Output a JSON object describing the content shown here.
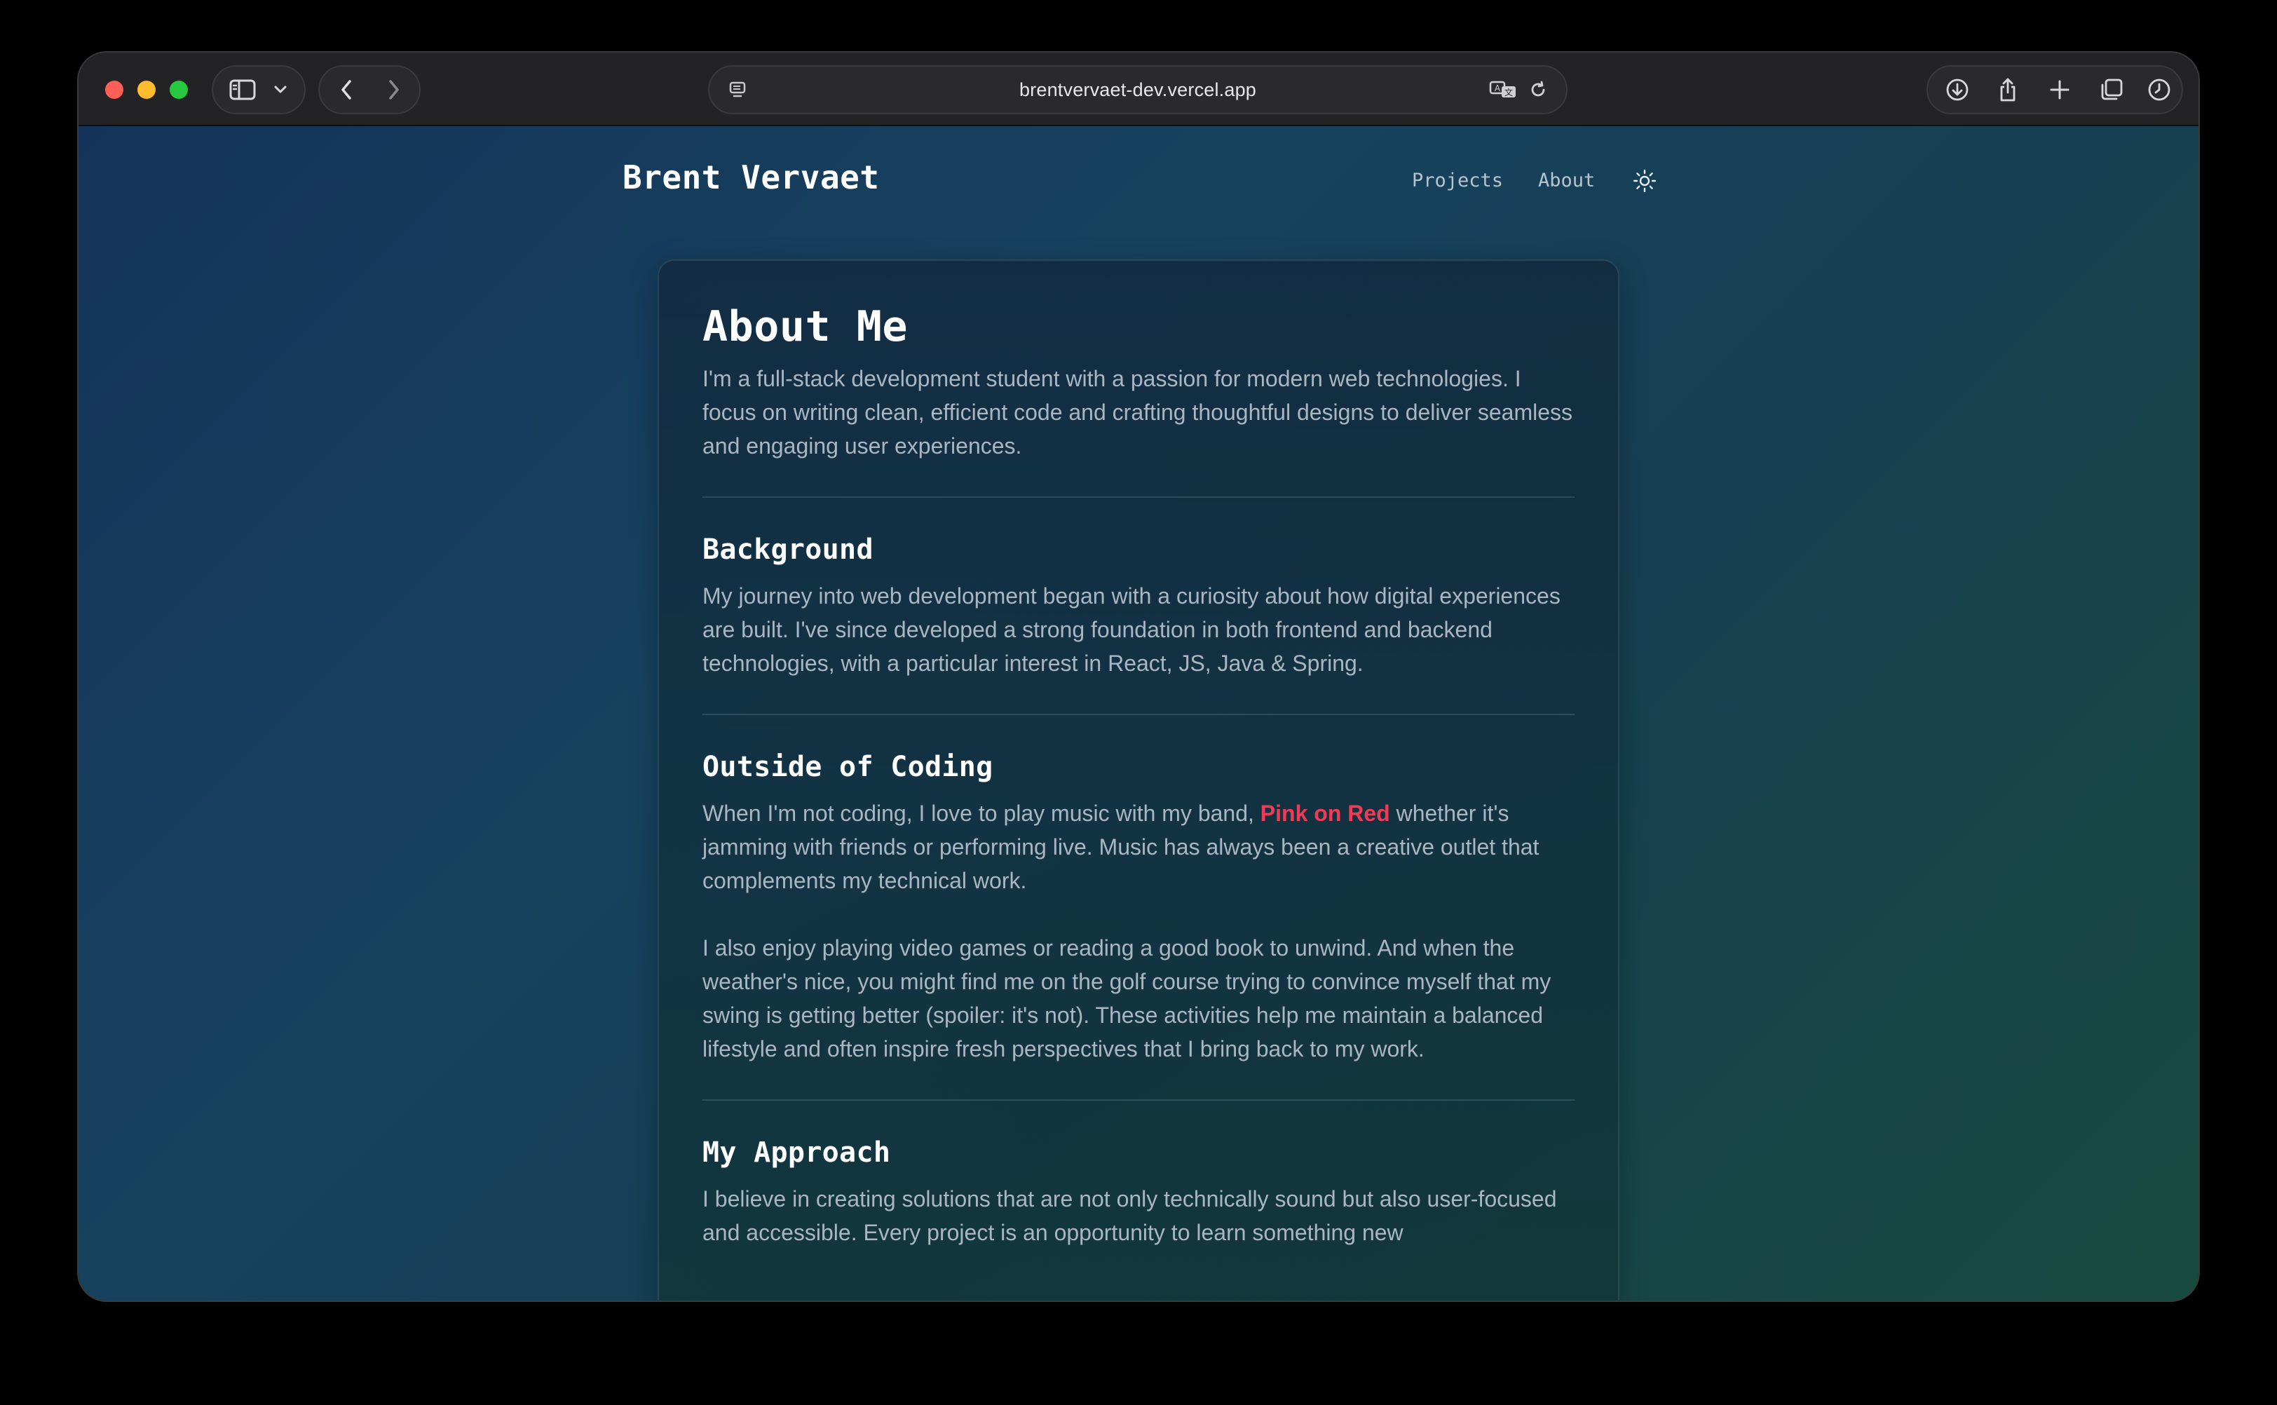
{
  "browser": {
    "address": "brentvervaet-dev.vercel.app",
    "icons": {
      "sidebar": "sidebar-icon",
      "tabs_menu": "chevron-down-icon",
      "back": "chevron-left-icon",
      "forward": "chevron-right-icon",
      "page_menu": "page-menu-icon",
      "translate": "translate-icon",
      "reload": "reload-icon",
      "download": "download-icon",
      "share": "share-icon",
      "new_tab": "plus-icon",
      "tab_overview": "tabs-icon",
      "history": "clock-icon"
    }
  },
  "site": {
    "brand": "Brent Vervaet",
    "nav": {
      "projects": "Projects",
      "about": "About"
    },
    "theme_icon": "sun-icon"
  },
  "about": {
    "title": "About Me",
    "intro": "I'm a full-stack development student with a passion for modern web technologies. I focus on writing clean, efficient code and crafting thoughtful designs to deliver seamless and engaging user experiences.",
    "background": {
      "heading": "Background",
      "text": "My journey into web development began with a curiosity about how digital experiences are built. I've since developed a strong foundation in both frontend and backend technologies, with a particular interest in React, JS, Java & Spring."
    },
    "outside": {
      "heading": "Outside of Coding",
      "p1_before": "When I'm not coding, I love to play music with my band, ",
      "band": "Pink on Red",
      "p1_after": " whether it's jamming with friends or performing live. Music has always been a creative outlet that complements my technical work.",
      "p2": "I also enjoy playing video games or reading a good book to unwind. And when the weather's nice, you might find me on the golf course trying to convince myself that my swing is getting better (spoiler: it's not). These activities help me maintain a balanced lifestyle and often inspire fresh perspectives that I bring back to my work."
    },
    "approach": {
      "heading": "My Approach",
      "text": "I believe in creating solutions that are not only technically sound but also user-focused and accessible. Every project is an opportunity to learn something new"
    }
  },
  "colors": {
    "accent_link": "#ef3b55",
    "text_muted": "#aab6c2",
    "heading": "#ffffff"
  }
}
